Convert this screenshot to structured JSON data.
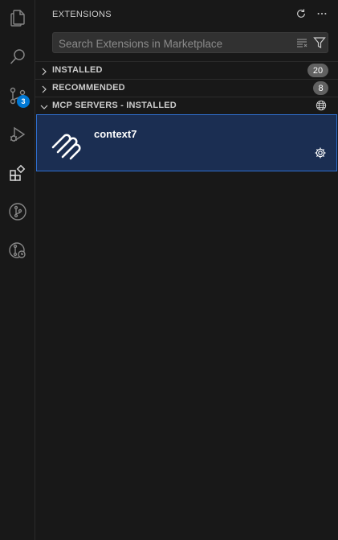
{
  "panel": {
    "title": "EXTENSIONS"
  },
  "search": {
    "placeholder": "Search Extensions in Marketplace",
    "value": ""
  },
  "activity_bar": {
    "items": [
      "explorer-icon",
      "search-icon",
      "source-control-icon",
      "run-debug-icon",
      "extensions-icon",
      "git-graph-icon",
      "git-history-icon"
    ],
    "source_control_badge": "3"
  },
  "sections": {
    "installed": {
      "label": "INSTALLED",
      "count": "20",
      "expanded": false
    },
    "recommended": {
      "label": "RECOMMENDED",
      "count": "8",
      "expanded": false
    },
    "mcp": {
      "label": "MCP SERVERS - INSTALLED",
      "expanded": true
    }
  },
  "mcp_servers": [
    {
      "name": "context7"
    }
  ],
  "colors": {
    "background": "#181818",
    "selected_bg": "#1b2e52",
    "selected_border": "#2f6fd0",
    "badge": "#0078d4",
    "count_bg": "#616161"
  }
}
